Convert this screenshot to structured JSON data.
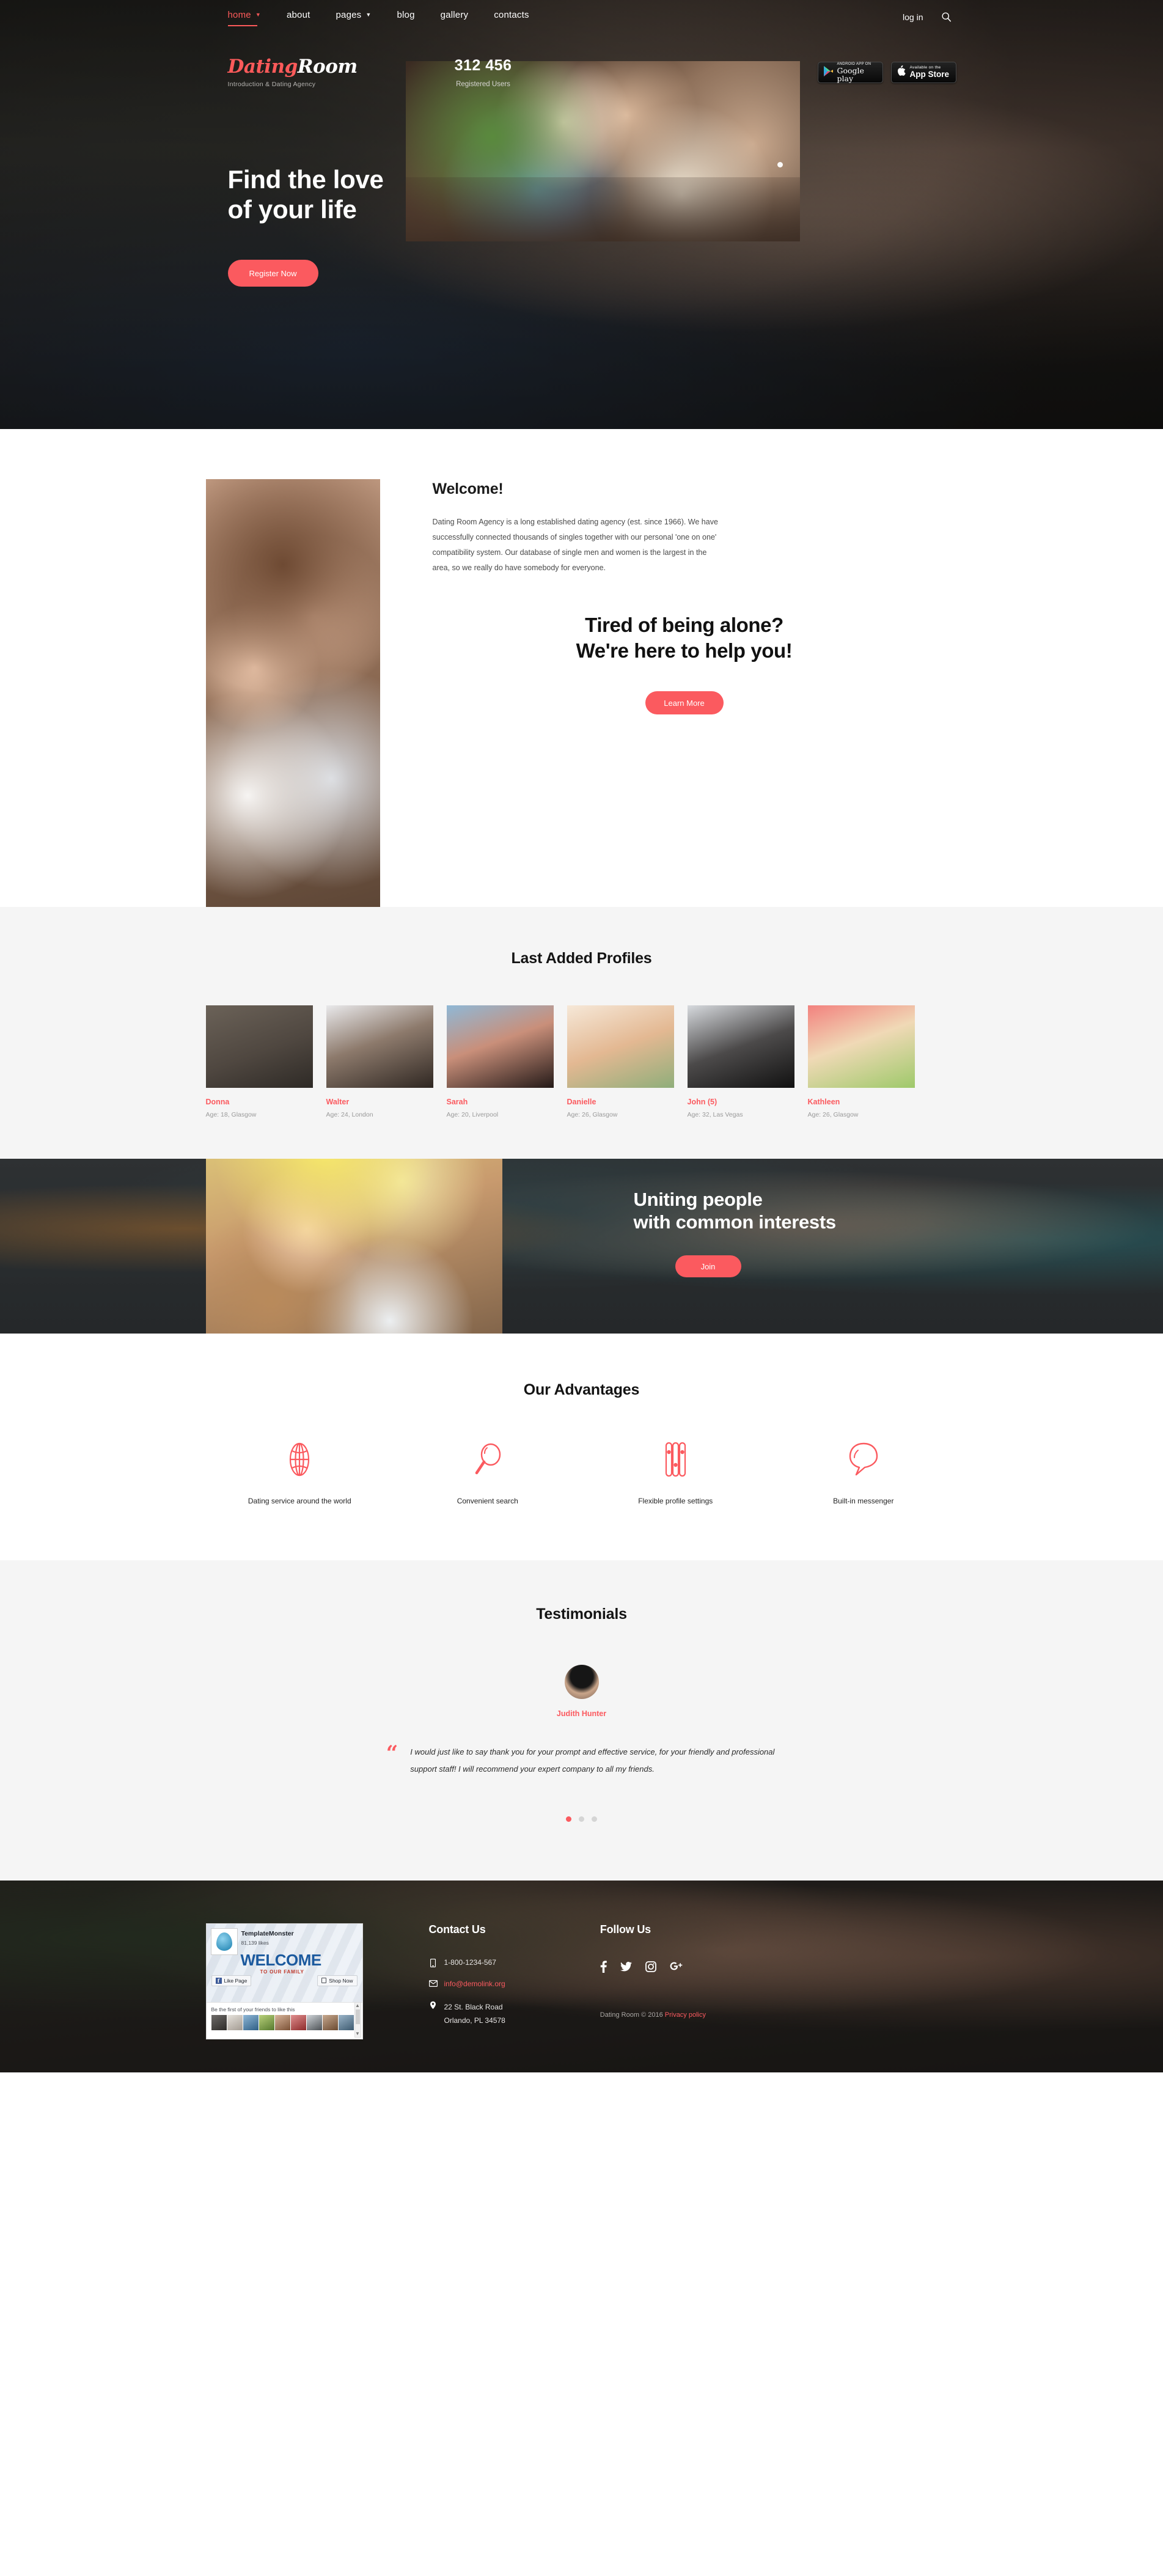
{
  "site": {
    "brand_primary": "Dating",
    "brand_secondary": "Room",
    "tagline": "Introduction & Dating Agency",
    "accent_color": "#fb5a5f"
  },
  "nav": {
    "items": [
      {
        "label": "home",
        "has_caret": true,
        "active": true
      },
      {
        "label": "about",
        "has_caret": false,
        "active": false
      },
      {
        "label": "pages",
        "has_caret": true,
        "active": false
      },
      {
        "label": "blog",
        "has_caret": false,
        "active": false
      },
      {
        "label": "gallery",
        "has_caret": false,
        "active": false
      },
      {
        "label": "contacts",
        "has_caret": false,
        "active": false
      }
    ],
    "login_label": "log in",
    "search_icon": "search-icon"
  },
  "counter": {
    "value": "312 456",
    "label": "Registered Users"
  },
  "app_buttons": [
    {
      "small": "ANDROID APP ON",
      "big": "Google play",
      "icon": "google-play-icon"
    },
    {
      "small": "Available on the",
      "big": "App Store",
      "icon": "apple-icon"
    }
  ],
  "hero": {
    "title_line1": "Find the love",
    "title_line2": "of your life",
    "cta": "Register Now"
  },
  "welcome": {
    "heading": "Welcome!",
    "paragraph": "Dating Room Agency is a long established dating agency (est. since 1966). We have successfully connected thousands of singles together with our personal 'one on one' compatibility system. Our database of single men and women is the largest in the area, so we really do have somebody for everyone.",
    "mid_line1": "Tired of being alone?",
    "mid_line2": "We're here to help you!",
    "cta": "Learn More"
  },
  "profiles": {
    "title": "Last Added Profiles",
    "items": [
      {
        "name": "Donna",
        "meta": "Age: 18, Glasgow"
      },
      {
        "name": "Walter",
        "meta": "Age: 24, London"
      },
      {
        "name": "Sarah",
        "meta": "Age: 20, Liverpool"
      },
      {
        "name": "Danielle",
        "meta": "Age: 26, Glasgow"
      },
      {
        "name": "John (5)",
        "meta": "Age: 32, Las Vegas"
      },
      {
        "name": "Kathleen",
        "meta": "Age: 26, Glasgow"
      }
    ]
  },
  "uniting": {
    "line1": "Uniting people",
    "line2": "with common interests",
    "cta": "Join"
  },
  "advantages": {
    "title": "Our Advantages",
    "items": [
      {
        "icon": "globe-icon",
        "label": "Dating service around the world"
      },
      {
        "icon": "magnifier-icon",
        "label": "Convenient search"
      },
      {
        "icon": "sliders-icon",
        "label": "Flexible profile settings"
      },
      {
        "icon": "chat-bubble-icon",
        "label": "Built-in messenger"
      }
    ]
  },
  "testimonials": {
    "title": "Testimonials",
    "author": "Judith Hunter",
    "quote": "I would just like to say thank you for your prompt and effective service, for your friendly and professional support staff! I will recommend your expert company to all my friends.",
    "dots": 3,
    "active_dot": 0
  },
  "fb_widget": {
    "page_name": "TemplateMonster",
    "likes": "81,139 likes",
    "cover_title": "WELCOME",
    "cover_sub": "TO OUR FAMILY",
    "like_button": "Like Page",
    "shop_button": "Shop Now",
    "footer_text": "Be the first of your friends to like this"
  },
  "footer": {
    "contact_title": "Contact Us",
    "phone": "1-800-1234-567",
    "email": "info@demolink.org",
    "address_line1": "22 St. Black Road",
    "address_line2": "Orlando, PL 34578",
    "follow_title": "Follow Us",
    "socials": [
      {
        "icon": "facebook-icon"
      },
      {
        "icon": "twitter-icon"
      },
      {
        "icon": "instagram-icon"
      },
      {
        "icon": "google-plus-icon"
      }
    ],
    "copyright": "Dating Room © 2016 ",
    "privacy": "Privacy policy"
  }
}
